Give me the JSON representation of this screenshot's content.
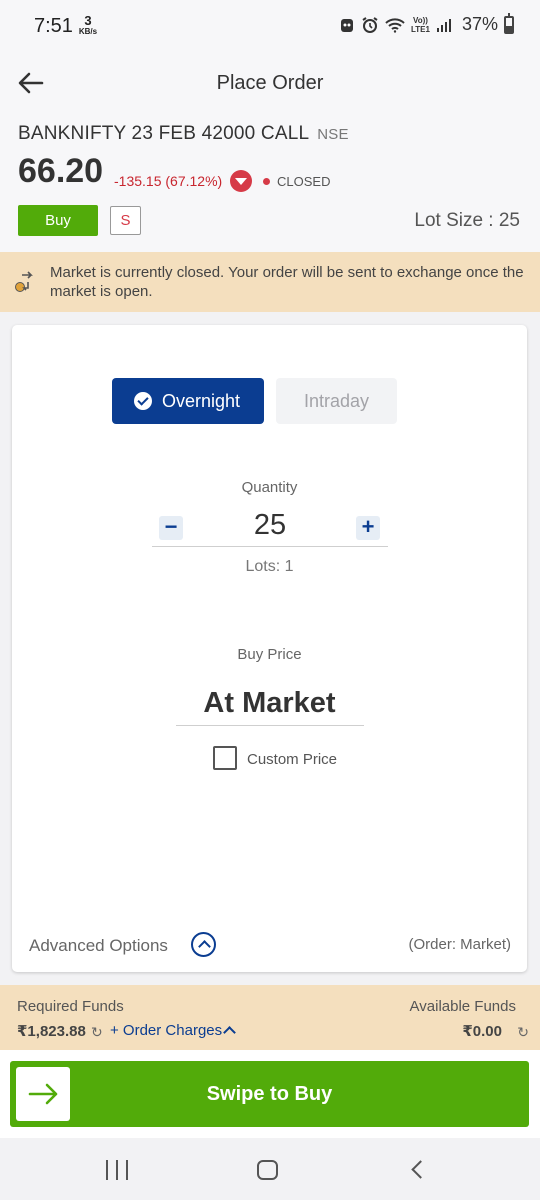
{
  "status_bar": {
    "time": "7:51",
    "net_speed_value": "3",
    "net_speed_unit": "KB/s",
    "network_label_top": "Vo))",
    "network_label_bottom": "LTE1",
    "battery": "37%"
  },
  "header": {
    "title": "Place Order",
    "instrument": "BANKNIFTY 23 FEB 42000 CALL",
    "exchange": "NSE",
    "ltp": "66.20",
    "change": "-135.15 (67.12%)",
    "market_status": "CLOSED",
    "buy_label": "Buy",
    "sell_label": "S",
    "lot_size": "Lot Size : 25"
  },
  "banner": {
    "message": "Market is currently closed. Your order will be sent to exchange once the market is open."
  },
  "order_form": {
    "product_types": [
      "Overnight",
      "Intraday"
    ],
    "selected_product": "Overnight",
    "quantity_label": "Quantity",
    "quantity_minus": "−",
    "quantity_value": "25",
    "quantity_plus": "+",
    "lots_text": "Lots: 1",
    "price_label": "Buy Price",
    "price_value": "At Market",
    "custom_price_label": "Custom Price",
    "custom_price_checked": false,
    "advanced_options_label": "Advanced Options",
    "order_type_text": "(Order: Market)"
  },
  "funds": {
    "required_label": "Required Funds",
    "required_value": "₹1,823.88",
    "order_charges_label": "+ Order Charges",
    "available_label": "Available Funds",
    "available_value": "₹0.00"
  },
  "swipe": {
    "label": "Swipe to Buy"
  },
  "colors": {
    "brand_blue": "#0b3d91",
    "buy_green": "#52ab0a",
    "loss_red": "#c8262f",
    "banner_bg": "#f4dfbe"
  },
  "icons": [
    "back-arrow-icon",
    "caret-down-icon",
    "check-icon",
    "chevron-up-icon",
    "refresh-icon",
    "arrow-right-icon",
    "exchange-icon"
  ]
}
